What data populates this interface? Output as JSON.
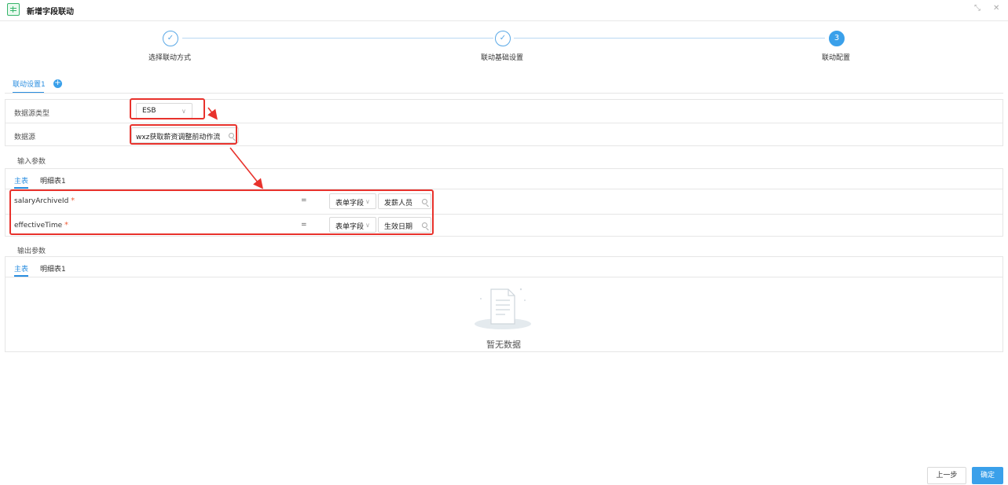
{
  "window": {
    "title": "新增字段联动",
    "minimize_icon": "shrink-icon",
    "close_icon": "close-icon"
  },
  "steps": [
    {
      "label": "选择联动方式",
      "status": "done",
      "mark": "✓"
    },
    {
      "label": "联动基础设置",
      "status": "done",
      "mark": "✓"
    },
    {
      "label": "联动配置",
      "status": "active",
      "mark": "3"
    }
  ],
  "setting_tab": {
    "label": "联动设置1",
    "add_icon": "+"
  },
  "form": {
    "datasource_type": {
      "label": "数据源类型",
      "value": "ESB"
    },
    "datasource": {
      "label": "数据源",
      "value": "wxz获取薪资调整前动作流"
    }
  },
  "input_params": {
    "title": "输入参数",
    "tabs": [
      "主表",
      "明细表1"
    ],
    "rows": [
      {
        "name": "salaryArchiveId",
        "required": "*",
        "op": "=",
        "type": "表单字段",
        "field": "发薪人员"
      },
      {
        "name": "effectiveTime",
        "required": "*",
        "op": "=",
        "type": "表单字段",
        "field": "生效日期"
      }
    ]
  },
  "output_params": {
    "title": "输出参数",
    "tabs": [
      "主表",
      "明细表1"
    ],
    "empty_text": "暂无数据"
  },
  "footer": {
    "prev_label": "上一步",
    "ok_label": "确定"
  },
  "colors": {
    "accent": "#3aa0ea",
    "annotation": "#e8322c"
  }
}
